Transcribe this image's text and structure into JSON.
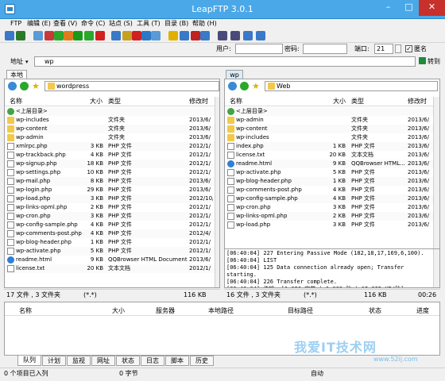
{
  "window": {
    "title": "LeapFTP 3.0.1",
    "minimize": "–",
    "maximize": "□",
    "close": "✕"
  },
  "menu": [
    {
      "label": "FTP"
    },
    {
      "label": "编辑 (E)"
    },
    {
      "label": "查看 (V)"
    },
    {
      "label": "命令 (C)"
    },
    {
      "label": "站点 (S)"
    },
    {
      "label": "工具 (T)"
    },
    {
      "label": "目录 (B)"
    },
    {
      "label": "帮助 (H)"
    }
  ],
  "toolbar": {
    "icons": [
      "open-icon",
      "settings-icon",
      "connect-icon",
      "disconnect-icon",
      "add-icon",
      "remove-icon",
      "refresh-icon",
      "play-icon",
      "stop-icon",
      "find-icon",
      "edit-icon",
      "delete-icon",
      "rename-icon",
      "view-icon",
      "lightning-icon",
      "transfer-icon",
      "queue-icon",
      "exit-icon",
      "binoculars-icon",
      "binoculars-2-icon",
      "compare-icon",
      "sync-icon"
    ],
    "colors": [
      "#3a78c8",
      "#2a7a2a",
      "#5a9ad6",
      "#c83a3a",
      "#2aa82a",
      "#e07a1a",
      "#1a9a1a",
      "#2aa82a",
      "#d02020",
      "#3a78c8",
      "#c8a020",
      "#d02020",
      "#2a78c8",
      "#5a9ad6",
      "#e0b000",
      "#3a78c8",
      "#c02020",
      "#3a78c8",
      "#4a4a7a",
      "#4a4a7a",
      "#3a78c8",
      "#3a78c8"
    ]
  },
  "login": {
    "user_label": "用户:",
    "user_value": "",
    "password_label": "密码:",
    "password_value": "",
    "port_label": "端口:",
    "port_value": "21",
    "anonymous_label": "匿名",
    "anonymous_checked": true
  },
  "address": {
    "label": "地址",
    "value": "wp",
    "go_label": "转到"
  },
  "local": {
    "tab": "本地",
    "path": "wordpress",
    "columns": [
      "名称",
      "大小",
      "类型",
      "修改时"
    ],
    "rows": [
      {
        "icon": "up",
        "name": "<上层目录>",
        "size": "",
        "type": "",
        "date": ""
      },
      {
        "icon": "folder",
        "name": "wp-includes",
        "size": "",
        "type": "文件夹",
        "date": "2013/6/"
      },
      {
        "icon": "folder",
        "name": "wp-content",
        "size": "",
        "type": "文件夹",
        "date": "2013/6/"
      },
      {
        "icon": "folder",
        "name": "wp-admin",
        "size": "",
        "type": "文件夹",
        "date": "2013/6/"
      },
      {
        "icon": "file",
        "name": "xmlrpc.php",
        "size": "3 KB",
        "type": "PHP 文件",
        "date": "2012/1/"
      },
      {
        "icon": "file",
        "name": "wp-trackback.php",
        "size": "4 KB",
        "type": "PHP 文件",
        "date": "2012/1/"
      },
      {
        "icon": "file",
        "name": "wp-signup.php",
        "size": "18 KB",
        "type": "PHP 文件",
        "date": "2012/1/"
      },
      {
        "icon": "file",
        "name": "wp-settings.php",
        "size": "10 KB",
        "type": "PHP 文件",
        "date": "2012/1/"
      },
      {
        "icon": "file",
        "name": "wp-mail.php",
        "size": "8 KB",
        "type": "PHP 文件",
        "date": "2013/6/"
      },
      {
        "icon": "file",
        "name": "wp-login.php",
        "size": "29 KB",
        "type": "PHP 文件",
        "date": "2013/6/"
      },
      {
        "icon": "file",
        "name": "wp-load.php",
        "size": "3 KB",
        "type": "PHP 文件",
        "date": "2012/10/"
      },
      {
        "icon": "file",
        "name": "wp-links-opml.php",
        "size": "2 KB",
        "type": "PHP 文件",
        "date": "2012/1/"
      },
      {
        "icon": "file",
        "name": "wp-cron.php",
        "size": "3 KB",
        "type": "PHP 文件",
        "date": "2012/1/"
      },
      {
        "icon": "file",
        "name": "wp-config-sample.php",
        "size": "4 KB",
        "type": "PHP 文件",
        "date": "2012/1/"
      },
      {
        "icon": "file",
        "name": "wp-comments-post.php",
        "size": "4 KB",
        "type": "PHP 文件",
        "date": "2012/4/"
      },
      {
        "icon": "file",
        "name": "wp-blog-header.php",
        "size": "1 KB",
        "type": "PHP 文件",
        "date": "2012/1/"
      },
      {
        "icon": "file",
        "name": "wp-activate.php",
        "size": "5 KB",
        "type": "PHP 文件",
        "date": "2012/1/"
      },
      {
        "icon": "ie",
        "name": "readme.html",
        "size": "9 KB",
        "type": "QQBrowser HTML Document",
        "date": "2013/6/"
      },
      {
        "icon": "file",
        "name": "license.txt",
        "size": "20 KB",
        "type": "文本文档",
        "date": "2012/1/"
      }
    ],
    "status_left": "17 文件 , 3 文件夹",
    "status_mid": "(*.*)",
    "status_right": "116 KB"
  },
  "remote": {
    "tab": "wp",
    "path": "Web",
    "columns": [
      "名称",
      "大小",
      "类型",
      "修改时"
    ],
    "rows": [
      {
        "icon": "up",
        "name": "<上层目录>",
        "size": "",
        "type": "",
        "date": ""
      },
      {
        "icon": "folder",
        "name": "wp-admin",
        "size": "",
        "type": "文件夹",
        "date": "2013/6/"
      },
      {
        "icon": "folder",
        "name": "wp-content",
        "size": "",
        "type": "文件夹",
        "date": "2013/6/"
      },
      {
        "icon": "folder",
        "name": "wp-includes",
        "size": "",
        "type": "文件夹",
        "date": "2013/6/"
      },
      {
        "icon": "file",
        "name": "index.php",
        "size": "1 KB",
        "type": "PHP 文件",
        "date": "2013/6/"
      },
      {
        "icon": "file",
        "name": "license.txt",
        "size": "20 KB",
        "type": "文本文档",
        "date": "2013/6/"
      },
      {
        "icon": "ie",
        "name": "readme.html",
        "size": "9 KB",
        "type": "QQBrowser HTML...",
        "date": "2013/6/"
      },
      {
        "icon": "file",
        "name": "wp-activate.php",
        "size": "5 KB",
        "type": "PHP 文件",
        "date": "2013/6/"
      },
      {
        "icon": "file",
        "name": "wp-blog-header.php",
        "size": "1 KB",
        "type": "PHP 文件",
        "date": "2013/6/"
      },
      {
        "icon": "file",
        "name": "wp-comments-post.php",
        "size": "4 KB",
        "type": "PHP 文件",
        "date": "2013/6/"
      },
      {
        "icon": "file",
        "name": "wp-config-sample.php",
        "size": "4 KB",
        "type": "PHP 文件",
        "date": "2013/6/"
      },
      {
        "icon": "file",
        "name": "wp-cron.php",
        "size": "3 KB",
        "type": "PHP 文件",
        "date": "2013/6/"
      },
      {
        "icon": "file",
        "name": "wp-links-opml.php",
        "size": "2 KB",
        "type": "PHP 文件",
        "date": "2013/6/"
      },
      {
        "icon": "file",
        "name": "wp-load.php",
        "size": "3 KB",
        "type": "PHP 文件",
        "date": "2013/6/"
      }
    ],
    "log": [
      "[06:40:04] 227 Entering Passive Mode (182,18,17,169,6,100).",
      "[06:40:04] LIST",
      "[06:40:04] 125 Data connection already open; Transfer",
      "starting.",
      "[06:40:04] 226 Transfer complete.",
      "[06:40:04] 传输: [1,028 字节 | 0.063 秒 | 15.935 KB/秒]"
    ],
    "status_left": "16 文件 , 3 文件夹",
    "status_mid": "(*.*)",
    "status_right": "116 KB",
    "status_time": "00:26"
  },
  "queue": {
    "columns": [
      "名称",
      "大小",
      "服务器",
      "本地路径",
      "目标路径",
      "状态",
      "进度"
    ],
    "tabs": [
      "队列",
      "计划",
      "监视",
      "网址",
      "状态",
      "日志",
      "脚本",
      "历史"
    ],
    "status_left": "0 个项目已入列",
    "status_mid": "0 字节",
    "status_right": "自动"
  },
  "watermark": {
    "text": "我爱IT技术网",
    "url": "www.52ij.com"
  }
}
